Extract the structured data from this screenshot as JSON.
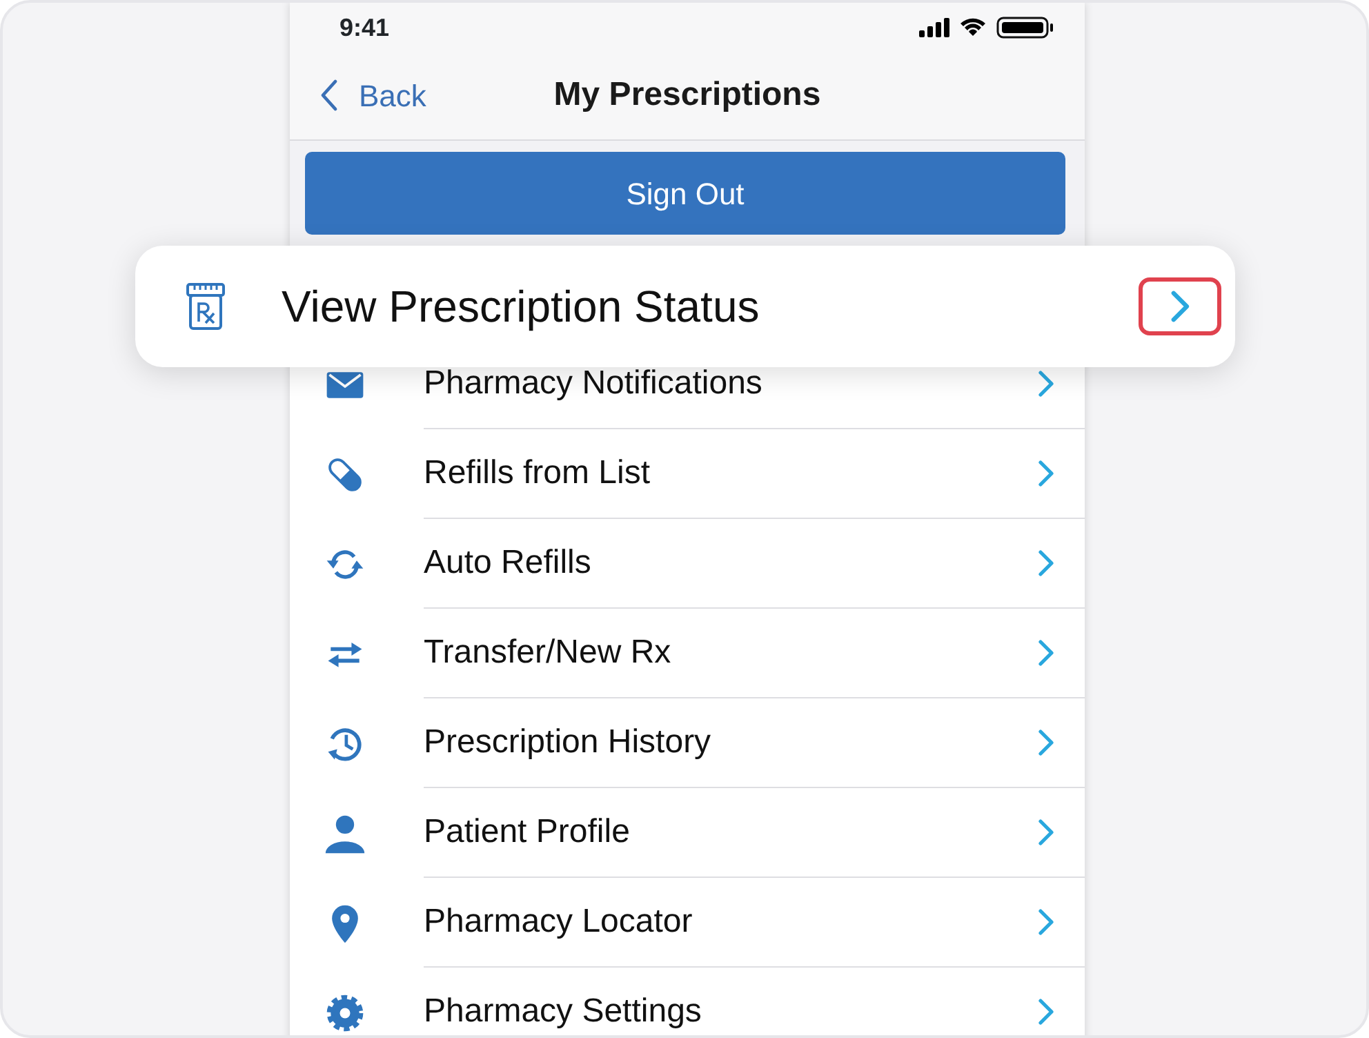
{
  "status_bar": {
    "time": "9:41"
  },
  "nav": {
    "back_label": "Back",
    "title": "My Prescriptions"
  },
  "sign_out_button": {
    "label": "Sign Out"
  },
  "highlighted_item": {
    "label": "View Prescription Status",
    "chevron_highlighted": true
  },
  "menu_items": [
    {
      "label": "Pharmacy Notifications"
    },
    {
      "label": "Refills from List"
    },
    {
      "label": "Auto Refills"
    },
    {
      "label": "Transfer/New Rx"
    },
    {
      "label": "Prescription History"
    },
    {
      "label": "Patient Profile"
    },
    {
      "label": "Pharmacy Locator"
    },
    {
      "label": "Pharmacy Settings"
    }
  ]
}
